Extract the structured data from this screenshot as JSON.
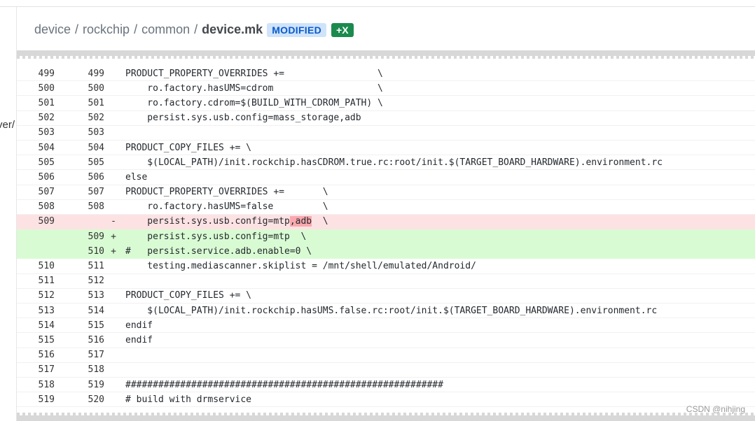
{
  "left_cut_text": "ver/",
  "breadcrumb": {
    "p1": "device",
    "p2": "rockchip",
    "p3": "common",
    "file": "device.mk",
    "sep": "/"
  },
  "badges": {
    "modified": "MODIFIED",
    "exec": "+X"
  },
  "rows": [
    {
      "o": "499",
      "n": "499",
      "m": "",
      "t": "PRODUCT_PROPERTY_OVERRIDES +=                 \\",
      "k": "ctx"
    },
    {
      "o": "500",
      "n": "500",
      "m": "",
      "t": "    ro.factory.hasUMS=cdrom                   \\",
      "k": "ctx"
    },
    {
      "o": "501",
      "n": "501",
      "m": "",
      "t": "    ro.factory.cdrom=$(BUILD_WITH_CDROM_PATH) \\",
      "k": "ctx"
    },
    {
      "o": "502",
      "n": "502",
      "m": "",
      "t": "    persist.sys.usb.config=mass_storage,adb",
      "k": "ctx"
    },
    {
      "o": "503",
      "n": "503",
      "m": "",
      "t": "",
      "k": "ctx"
    },
    {
      "o": "504",
      "n": "504",
      "m": "",
      "t": "PRODUCT_COPY_FILES += \\",
      "k": "ctx"
    },
    {
      "o": "505",
      "n": "505",
      "m": "",
      "t": "    $(LOCAL_PATH)/init.rockchip.hasCDROM.true.rc:root/init.$(TARGET_BOARD_HARDWARE).environment.rc",
      "k": "ctx"
    },
    {
      "o": "506",
      "n": "506",
      "m": "",
      "t": "else",
      "k": "ctx"
    },
    {
      "o": "507",
      "n": "507",
      "m": "",
      "t": "PRODUCT_PROPERTY_OVERRIDES +=       \\",
      "k": "ctx"
    },
    {
      "o": "508",
      "n": "508",
      "m": "",
      "t": "    ro.factory.hasUMS=false         \\",
      "k": "ctx"
    },
    {
      "o": "509",
      "n": "",
      "m": "-",
      "t": "    persist.sys.usb.config=mtp",
      "hl": ",adb",
      "t2": "  \\",
      "k": "del"
    },
    {
      "o": "",
      "n": "509",
      "m": "+",
      "t": "    persist.sys.usb.config=mtp  \\",
      "k": "add"
    },
    {
      "o": "",
      "n": "510",
      "m": "+",
      "t": "#   persist.service.adb.enable=0 \\",
      "k": "add"
    },
    {
      "o": "510",
      "n": "511",
      "m": "",
      "t": "    testing.mediascanner.skiplist = /mnt/shell/emulated/Android/",
      "k": "ctx"
    },
    {
      "o": "511",
      "n": "512",
      "m": "",
      "t": "",
      "k": "ctx"
    },
    {
      "o": "512",
      "n": "513",
      "m": "",
      "t": "PRODUCT_COPY_FILES += \\",
      "k": "ctx"
    },
    {
      "o": "513",
      "n": "514",
      "m": "",
      "t": "    $(LOCAL_PATH)/init.rockchip.hasUMS.false.rc:root/init.$(TARGET_BOARD_HARDWARE).environment.rc",
      "k": "ctx"
    },
    {
      "o": "514",
      "n": "515",
      "m": "",
      "t": "endif",
      "k": "ctx"
    },
    {
      "o": "515",
      "n": "516",
      "m": "",
      "t": "endif",
      "k": "ctx"
    },
    {
      "o": "516",
      "n": "517",
      "m": "",
      "t": "",
      "k": "ctx"
    },
    {
      "o": "517",
      "n": "518",
      "m": "",
      "t": "",
      "k": "ctx"
    },
    {
      "o": "518",
      "n": "519",
      "m": "",
      "t": "##########################################################",
      "k": "ctx"
    },
    {
      "o": "519",
      "n": "520",
      "m": "",
      "t": "# build with drmservice",
      "k": "ctx"
    }
  ],
  "watermark": "CSDN @nihjing"
}
